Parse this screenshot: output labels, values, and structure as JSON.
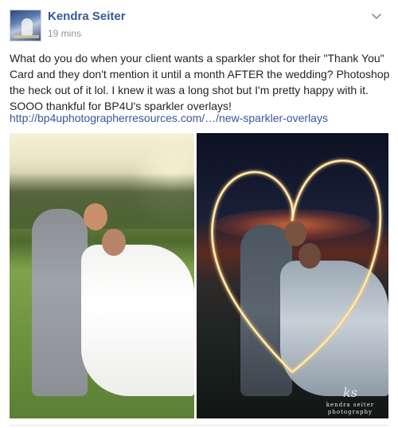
{
  "post": {
    "author": "Kendra Seiter",
    "timestamp": "19 mins",
    "text": "What do you do when your client wants a sparkler shot for their \"Thank You\" Card and they don't mention it until a month AFTER the wedding? Photoshop the heck out of it lol. I knew it was a long shot but I'm pretty happy with it. SOOO thankful for BP4U's sparkler overlays!",
    "link": "http://bp4uphotographerresources.com/…/new-sparkler-overlays",
    "watermark": {
      "mark": "ks",
      "line1": "kendra seiter",
      "line2": "photography"
    }
  },
  "icons": {
    "menu": "chevron-down-icon",
    "avatar": "profile-avatar"
  },
  "colors": {
    "author_link": "#365899",
    "meta_text": "#90949c",
    "body_text": "#1d2129",
    "sparkler": "#ffd27a"
  }
}
